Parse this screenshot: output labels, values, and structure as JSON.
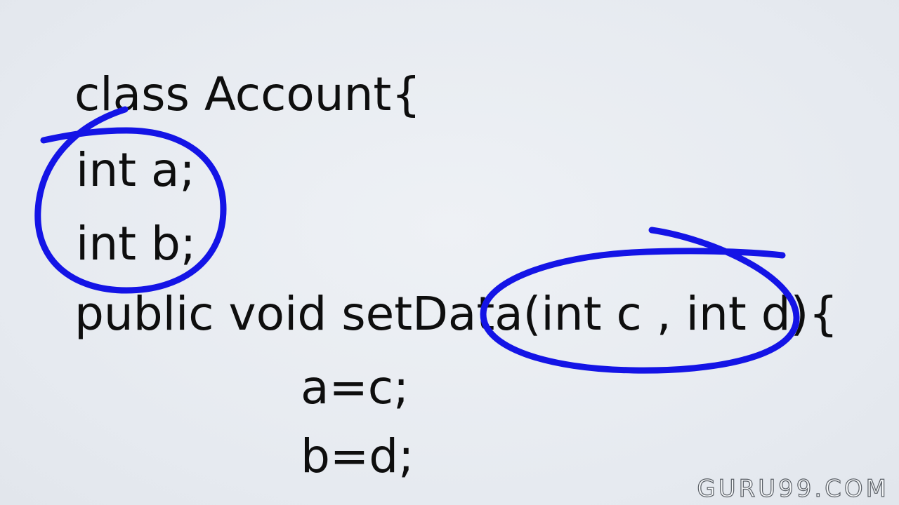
{
  "code": {
    "lines": [
      "class Account{",
      "int a;",
      "int b;",
      "public void setData(int c , int d){",
      "a=c;",
      "b=d;"
    ]
  },
  "annotation": {
    "color": "#1414e6",
    "circled": [
      "int a; int b;",
      "(int c , int d)"
    ]
  },
  "watermark": {
    "text": "GURU99.COM"
  }
}
